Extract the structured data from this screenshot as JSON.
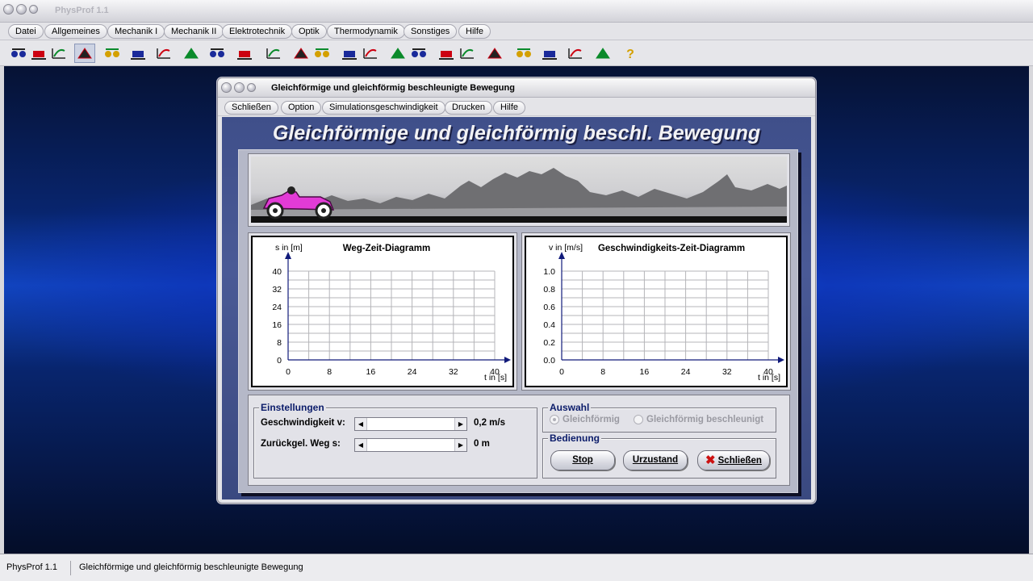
{
  "app": {
    "title": "PhysProf 1.1",
    "menu": [
      "Datei",
      "Allgemeines",
      "Mechanik I",
      "Mechanik II",
      "Elektrotechnik",
      "Optik",
      "Thermodynamik",
      "Sonstiges",
      "Hilfe"
    ],
    "toolbar_icons": [
      "collision-icon",
      "weight-cart-icon",
      "exchange-arrows-icon",
      "hill-icon",
      "spring-balance-icon",
      "slope-ramp-icon",
      "graph-axes-icon",
      "eye-lens-icon",
      "dots-grid-icon",
      "wave-icon",
      "pendulum-icon",
      "heater-icon",
      "rotate-tool-icon",
      "vertical-measure-icon",
      "line-chart-icon",
      "scale-balance-icon",
      "magnet-field-icon",
      "person-icon",
      "camera-icon",
      "pump-icon",
      "lever-icon",
      "triangle-color-icon",
      "distribution-curve-icon",
      "area-curve-icon",
      "help-question-icon"
    ],
    "active_tool": 3
  },
  "window": {
    "title": "Gleichförmige und gleichförmig beschleunigte Bewegung",
    "menu": [
      "Schließen",
      "Option",
      "Simulationsgeschwindigkeit",
      "Drucken",
      "Hilfe"
    ],
    "heading": "Gleichförmige und gleichförmig beschl. Bewegung"
  },
  "charts": {
    "left": {
      "title": "Weg-Zeit-Diagramm",
      "ylabel": "s in [m]",
      "xlabel": "t in [s]"
    },
    "right": {
      "title": "Geschwindigkeits-Zeit-Diagramm",
      "ylabel": "v in [m/s]",
      "xlabel": "t in [s]"
    }
  },
  "chart_data": [
    {
      "type": "line",
      "title": "Weg-Zeit-Diagramm",
      "xlabel": "t in [s]",
      "ylabel": "s in [m]",
      "xlim": [
        0,
        40
      ],
      "ylim": [
        0,
        40
      ],
      "x_ticks": [
        "0",
        "8",
        "16",
        "24",
        "32",
        "40"
      ],
      "y_ticks": [
        "0",
        "8",
        "16",
        "24",
        "32",
        "40"
      ],
      "grid": true,
      "series": []
    },
    {
      "type": "line",
      "title": "Geschwindigkeits-Zeit-Diagramm",
      "xlabel": "t in [s]",
      "ylabel": "v in [m/s]",
      "xlim": [
        0,
        40
      ],
      "ylim": [
        0,
        1.0
      ],
      "x_ticks": [
        "0",
        "8",
        "16",
        "24",
        "32",
        "40"
      ],
      "y_ticks": [
        "0.0",
        "0.2",
        "0.4",
        "0.6",
        "0.8",
        "1.0"
      ],
      "grid": true,
      "series": []
    }
  ],
  "settings": {
    "group_label": "Einstellungen",
    "speed_label": "Geschwindigkeit v:",
    "speed_value": "0,2 m/s",
    "speed_fraction": 0.0,
    "distance_label": "Zurückgel. Weg s:",
    "distance_value": "0 m",
    "distance_fraction": 0.0
  },
  "auswahl": {
    "group_label": "Auswahl",
    "option1": "Gleichförmig",
    "option2": "Gleichförmig beschleunigt",
    "selected": "Gleichförmig"
  },
  "bedienung": {
    "group_label": "Bedienung",
    "stop": "Stop",
    "reset": "Urzustand",
    "close": "Schließen"
  },
  "status": {
    "app": "PhysProf 1.1",
    "message": "Gleichförmige und gleichförmig beschleunigte Bewegung"
  },
  "colors": {
    "desktop": "#0b2f9a",
    "window_client": "#44548f",
    "car": "#e23bd6",
    "axis_arrow": "#101a7a"
  }
}
